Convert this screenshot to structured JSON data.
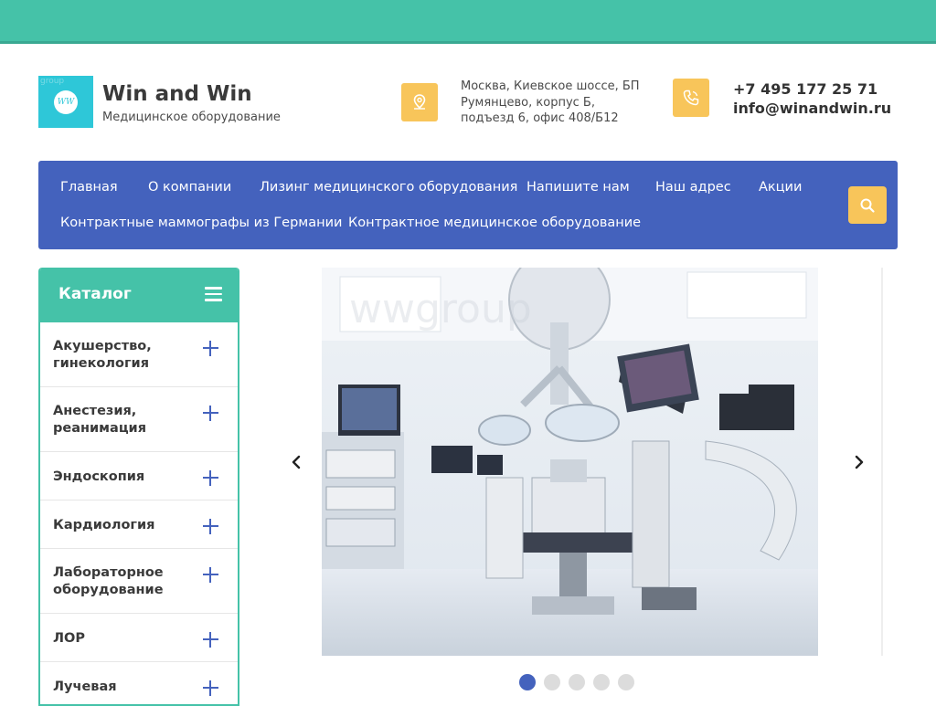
{
  "brand": {
    "name": "Win and Win",
    "subtitle": "Медицинское оборудование",
    "logo_text": "WW",
    "logo_watermark": "group"
  },
  "address": {
    "lines": [
      "Москва, Киевское шоссе, БП",
      "Румянцево, корпус Б,",
      "подъезд 6, офис 408/Б12"
    ]
  },
  "contact": {
    "phone": "+7 495 177 25 71",
    "email": "info@winandwin.ru"
  },
  "nav": {
    "items": [
      "Главная",
      "О компании",
      "Лизинг медицинского оборудования",
      "Напишите нам",
      "Наш адрес",
      "Акции",
      "Контрактные маммографы из Германии",
      "Контрактное медицинское оборудование"
    ]
  },
  "catalog": {
    "title": "Каталог",
    "items": [
      [
        "Акушерство,",
        "гинекология"
      ],
      [
        "Анестезия,",
        "реанимация"
      ],
      [
        "Эндоскопия"
      ],
      [
        "Кардиология"
      ],
      [
        "Лабораторное",
        "оборудование"
      ],
      [
        "ЛОР"
      ],
      [
        "Лучевая"
      ]
    ]
  },
  "slider": {
    "slide_count": 5,
    "active_index": 0,
    "watermark": "wwgroup"
  },
  "colors": {
    "teal": "#45c2a8",
    "nav_blue": "#4462bd",
    "accent_yellow": "#f8c55a",
    "logo_cyan": "#2ec7d8"
  },
  "icons": {
    "address": "map-pin-icon",
    "phone": "phone-icon",
    "search": "search-icon",
    "menu": "menu-icon",
    "expand": "plus-icon",
    "prev": "chevron-left-icon",
    "next": "chevron-right-icon"
  }
}
